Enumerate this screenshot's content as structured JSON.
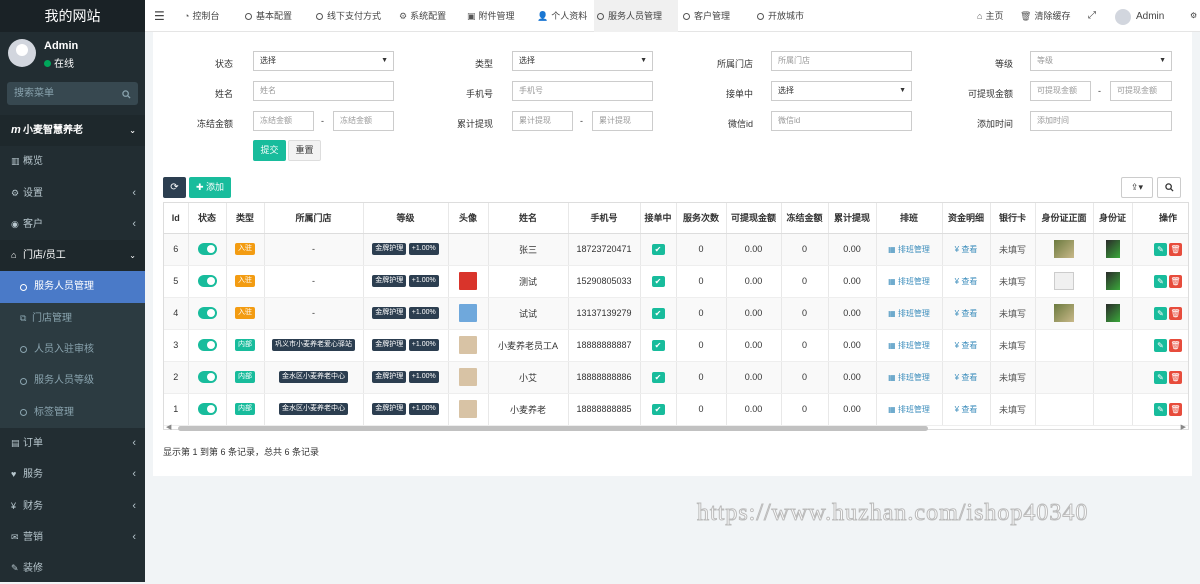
{
  "sidebar": {
    "logo": "我的网站",
    "user_name": "Admin",
    "user_status": "在线",
    "search_placeholder": "搜索菜单",
    "items": [
      {
        "label": "小麦智慧养老",
        "icon": "m-logo-icon",
        "type": "brand",
        "chevron": "down"
      },
      {
        "label": "概览",
        "icon": "bar-chart-icon",
        "type": "item"
      },
      {
        "label": "设置",
        "icon": "gear-icon",
        "type": "item",
        "chevron": "left"
      },
      {
        "label": "客户",
        "icon": "user-circle-icon",
        "type": "item",
        "chevron": "left"
      },
      {
        "label": "门店/员工",
        "icon": "bank-icon",
        "type": "open",
        "chevron": "down"
      },
      {
        "label": "服务人员管理",
        "icon": "circle-icon",
        "type": "sub-active"
      },
      {
        "label": "门店管理",
        "icon": "sitemap-icon",
        "type": "sub"
      },
      {
        "label": "人员入驻审核",
        "icon": "circle-icon",
        "type": "sub"
      },
      {
        "label": "服务人员等级",
        "icon": "circle-icon",
        "type": "sub"
      },
      {
        "label": "标签管理",
        "icon": "circle-icon",
        "type": "sub"
      },
      {
        "label": "订单",
        "icon": "file-icon",
        "type": "item",
        "chevron": "left"
      },
      {
        "label": "服务",
        "icon": "heart-icon",
        "type": "item",
        "chevron": "left"
      },
      {
        "label": "财务",
        "icon": "yen-icon",
        "type": "item",
        "chevron": "left"
      },
      {
        "label": "营销",
        "icon": "comments-icon",
        "type": "item",
        "chevron": "left"
      },
      {
        "label": "装修",
        "icon": "paint-icon",
        "type": "item"
      }
    ]
  },
  "topbar": {
    "tabs": [
      {
        "label": "控制台",
        "icon": "dashboard-icon"
      },
      {
        "label": "基本配置",
        "icon": "circle-icon"
      },
      {
        "label": "线下支付方式",
        "icon": "circle-icon"
      },
      {
        "label": "系统配置",
        "icon": "gear-icon"
      },
      {
        "label": "附件管理",
        "icon": "image-icon"
      },
      {
        "label": "个人资料",
        "icon": "user-icon"
      },
      {
        "label": "服务人员管理",
        "icon": "circle-icon"
      },
      {
        "label": "客户管理",
        "icon": "circle-icon"
      },
      {
        "label": "开放城市",
        "icon": "circle-icon"
      }
    ],
    "home_label": "主页",
    "clear_cache_label": "清除缓存",
    "admin_label": "Admin"
  },
  "filters": {
    "status_label": "状态",
    "status_value": "选择",
    "type_label": "类型",
    "type_value": "选择",
    "store_label": "所属门店",
    "store_placeholder": "所属门店",
    "level_label": "等级",
    "level_placeholder": "等级",
    "name_label": "姓名",
    "name_placeholder": "姓名",
    "phone_label": "手机号",
    "phone_placeholder": "手机号",
    "accepting_label": "接单中",
    "accepting_value": "选择",
    "withdrawable_label": "可提现金额",
    "withdrawable_placeholder": "可提现金额",
    "frozen_label": "冻结金额",
    "frozen_placeholder": "冻结金额",
    "total_withdraw_label": "累计提现",
    "total_withdraw_placeholder": "累计提现",
    "wechat_label": "微信id",
    "wechat_placeholder": "微信id",
    "added_label": "添加时间",
    "added_placeholder": "添加时间",
    "range_dash": "-",
    "submit_label": "提交",
    "reset_label": "重置"
  },
  "toolbar": {
    "add_label": "添加"
  },
  "table": {
    "columns": [
      "Id",
      "状态",
      "类型",
      "所属门店",
      "等级",
      "头像",
      "姓名",
      "手机号",
      "接单中",
      "服务次数",
      "可提现金额",
      "冻结金额",
      "累计提现",
      "排班",
      "资金明细",
      "银行卡",
      "身份证正面",
      "身份证",
      "操作"
    ],
    "rows": [
      {
        "id": "6",
        "type": "入驻",
        "type_color": "orange",
        "store": "-",
        "level": "金牌护理",
        "level_pct": "+1.00%",
        "avatar": "none",
        "name": "张三",
        "phone": "18723720471",
        "services": "0",
        "withdrawable": "0.00",
        "frozen": "0",
        "total": "0.00",
        "schedule": "排班管理",
        "funds": "¥ 查看",
        "bank": "未填写",
        "id_img": "photo"
      },
      {
        "id": "5",
        "type": "入驻",
        "type_color": "orange",
        "store": "-",
        "level": "金牌护理",
        "level_pct": "+1.00%",
        "avatar": "red",
        "name": "测试",
        "phone": "15290805033",
        "services": "0",
        "withdrawable": "0.00",
        "frozen": "0",
        "total": "0.00",
        "schedule": "排班管理",
        "funds": "¥ 查看",
        "bank": "未填写",
        "id_img": "doc"
      },
      {
        "id": "4",
        "type": "入驻",
        "type_color": "orange",
        "store": "-",
        "level": "金牌护理",
        "level_pct": "+1.00%",
        "avatar": "blue",
        "name": "试试",
        "phone": "13137139279",
        "services": "0",
        "withdrawable": "0.00",
        "frozen": "0",
        "total": "0.00",
        "schedule": "排班管理",
        "funds": "¥ 查看",
        "bank": "未填写",
        "id_img": "photo"
      },
      {
        "id": "3",
        "type": "内部",
        "type_color": "green",
        "store": "巩义市小麦养老爱心驿站",
        "level": "金牌护理",
        "level_pct": "+1.00%",
        "avatar": "tan",
        "name": "小麦养老员工A",
        "phone": "18888888887",
        "services": "0",
        "withdrawable": "0.00",
        "frozen": "0",
        "total": "0.00",
        "schedule": "排班管理",
        "funds": "¥ 查看",
        "bank": "未填写",
        "id_img": "none"
      },
      {
        "id": "2",
        "type": "内部",
        "type_color": "green",
        "store": "金水区小麦养老中心",
        "level": "金牌护理",
        "level_pct": "+1.00%",
        "avatar": "tan",
        "name": "小艾",
        "phone": "18888888886",
        "services": "0",
        "withdrawable": "0.00",
        "frozen": "0",
        "total": "0.00",
        "schedule": "排班管理",
        "funds": "¥ 查看",
        "bank": "未填写",
        "id_img": "none"
      },
      {
        "id": "1",
        "type": "内部",
        "type_color": "green",
        "store": "金水区小麦养老中心",
        "level": "金牌护理",
        "level_pct": "+1.00%",
        "avatar": "tan",
        "name": "小麦养老",
        "phone": "18888888885",
        "services": "0",
        "withdrawable": "0.00",
        "frozen": "0",
        "total": "0.00",
        "schedule": "排班管理",
        "funds": "¥ 查看",
        "bank": "未填写",
        "id_img": "none"
      }
    ]
  },
  "pagination": {
    "info": "显示第 1 到第 6 条记录，总共 6 条记录"
  },
  "watermark": "https://www.huzhan.com/ishop40340",
  "colors": {
    "sidebar_bg": "#222d32",
    "accent": "#18bc9c",
    "active_menu": "#4a7ac8",
    "label_orange": "#f39c12",
    "navy": "#2c3e50",
    "danger": "#e74c3c"
  }
}
